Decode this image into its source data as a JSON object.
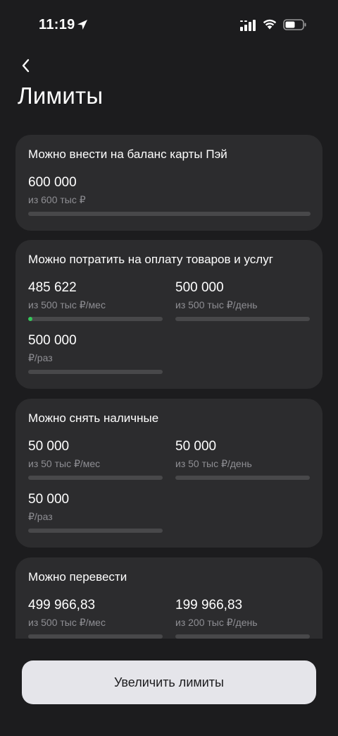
{
  "status": {
    "time": "11:19"
  },
  "page": {
    "title": "Лимиты"
  },
  "cards": [
    {
      "title": "Можно внести на баланс карты Пэй",
      "limits": [
        {
          "value": "600 000",
          "sub": "из 600 тыс ₽",
          "fill": 0
        }
      ]
    },
    {
      "title": "Можно потратить на оплату товаров и услуг",
      "limits": [
        {
          "value": "485 622",
          "sub": "из 500 тыс ₽/мес",
          "fill": 0.03
        },
        {
          "value": "500 000",
          "sub": "из 500 тыс ₽/день",
          "fill": 0
        },
        {
          "value": "500 000",
          "sub": "₽/раз",
          "fill": 0
        }
      ]
    },
    {
      "title": "Можно снять наличные",
      "limits": [
        {
          "value": "50 000",
          "sub": "из 50 тыс ₽/мес",
          "fill": 0
        },
        {
          "value": "50 000",
          "sub": "из 50 тыс ₽/день",
          "fill": 0
        },
        {
          "value": "50 000",
          "sub": "₽/раз",
          "fill": 0
        }
      ]
    },
    {
      "title": "Можно перевести",
      "limits": [
        {
          "value": "499 966,83",
          "sub": "из 500 тыс ₽/мес",
          "fill": 0
        },
        {
          "value": "199 966,83",
          "sub": "из 200 тыс ₽/день",
          "fill": 0
        }
      ]
    }
  ],
  "actions": {
    "increase_label": "Увеличить лимиты"
  },
  "colors": {
    "background": "#1c1c1e",
    "card": "#2c2c2e",
    "progress": "#34c759",
    "track": "#48484a",
    "button": "#e5e5ea"
  },
  "icons": {
    "back": "chevron-left-icon",
    "location": "location-arrow-icon",
    "signal": "cellular-signal-icon",
    "wifi": "wifi-icon",
    "battery": "battery-icon"
  }
}
